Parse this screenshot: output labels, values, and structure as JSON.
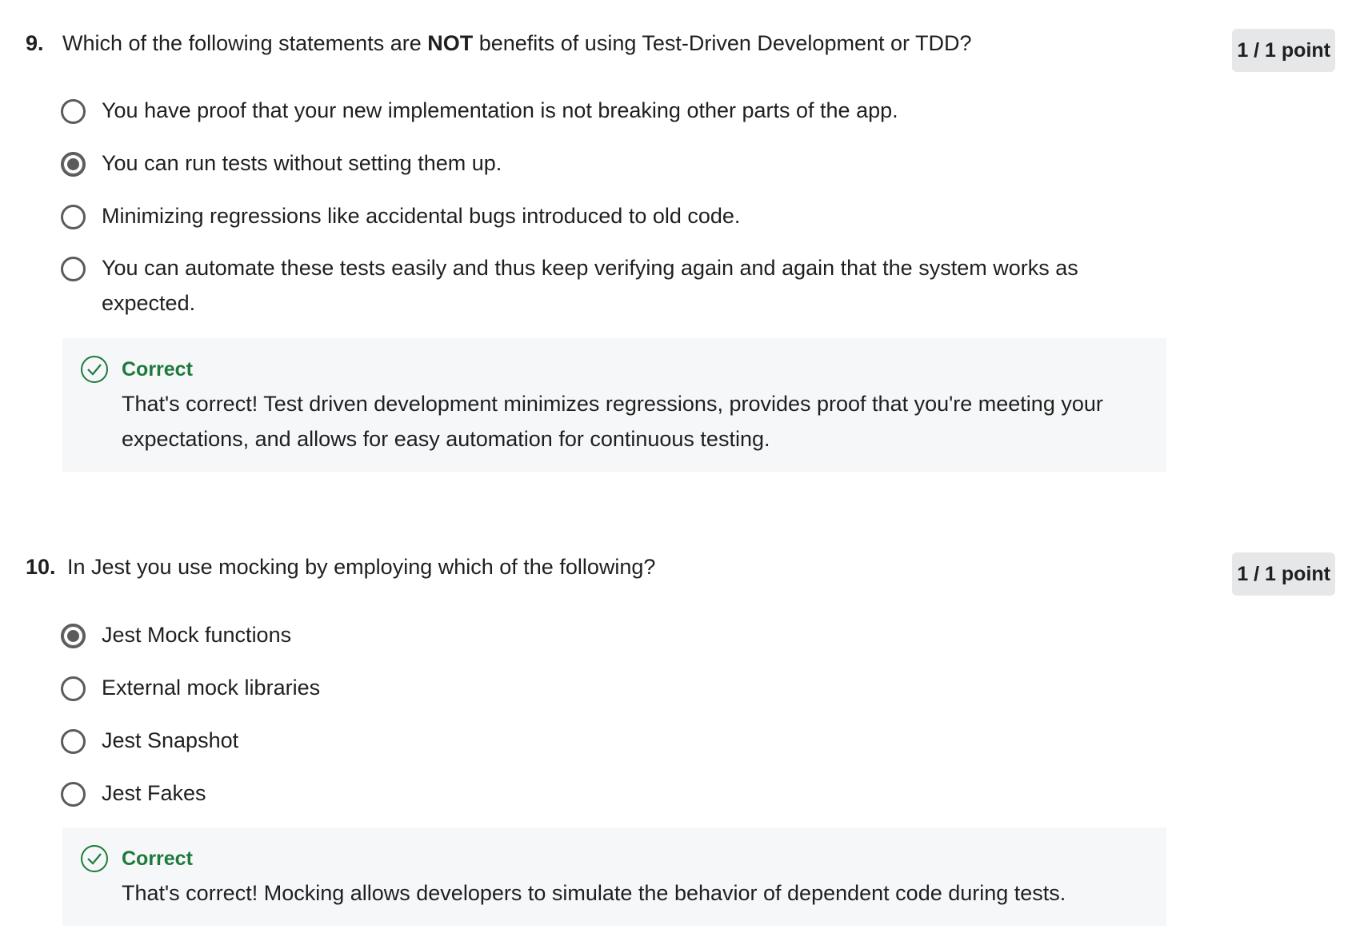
{
  "questions": [
    {
      "number": "9.",
      "text_before": "Which of the following statements are ",
      "text_bold": "NOT",
      "text_after": " benefits of using Test-Driven Development or TDD?",
      "points": "1 / 1 point",
      "options": [
        {
          "label": "You have proof that your new implementation is not breaking other parts of the app.",
          "selected": false
        },
        {
          "label": "You can run tests without setting them up.",
          "selected": true
        },
        {
          "label": "Minimizing regressions like accidental bugs introduced to old code.",
          "selected": false
        },
        {
          "label": "You can automate these tests easily and thus keep verifying again and again that the system works as expected.",
          "selected": false
        }
      ],
      "feedback": {
        "title": "Correct",
        "text": "That's correct! Test driven development minimizes regressions, provides proof that you're meeting your expectations, and allows for easy automation for continuous testing."
      }
    },
    {
      "number": "10.",
      "text_before": "In Jest you use mocking by employing which of the following?",
      "points": "1 / 1 point",
      "options": [
        {
          "label": "Jest Mock functions",
          "selected": true
        },
        {
          "label": "External mock libraries",
          "selected": false
        },
        {
          "label": "Jest Snapshot",
          "selected": false
        },
        {
          "label": "Jest Fakes",
          "selected": false
        }
      ],
      "feedback": {
        "title": "Correct",
        "text": "That's correct! Mocking allows developers to simulate the behavior of dependent code during tests."
      }
    }
  ],
  "colors": {
    "correct": "#1e7a3c",
    "feedback_bg": "#f5f7f8",
    "points_bg": "#e6e7e8",
    "radio": "#5b5b5b"
  }
}
